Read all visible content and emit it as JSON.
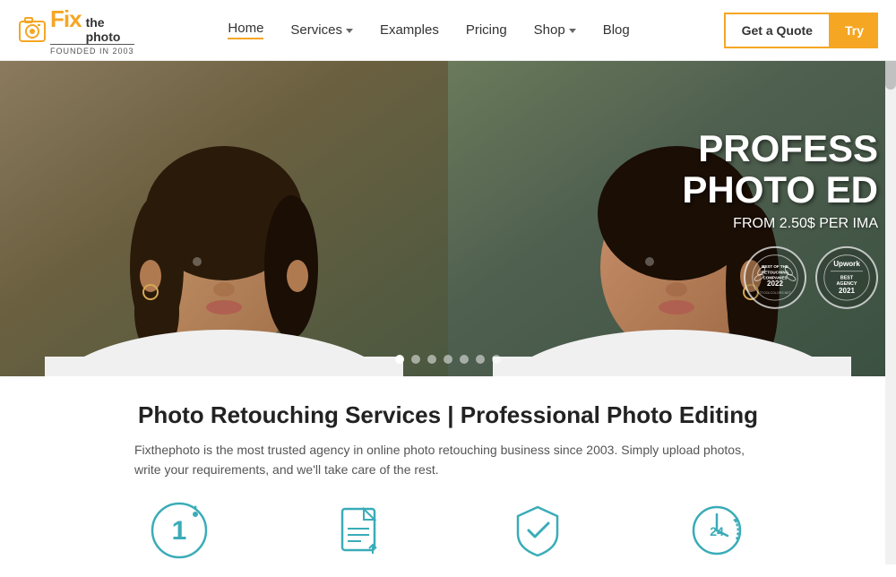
{
  "header": {
    "logo": {
      "fix": "Fix",
      "thephoto_line1": "the",
      "thephoto_line2": "photo",
      "founded": "FOUNDED IN 2003"
    },
    "nav": {
      "home": "Home",
      "services": "Services",
      "examples": "Examples",
      "pricing": "Pricing",
      "shop": "Shop",
      "blog": "Blog"
    },
    "buttons": {
      "quote": "Get a Quote",
      "try": "Try"
    }
  },
  "hero": {
    "title_line1": "PROFESS",
    "title_line2": "PHOTO ED",
    "subtitle": "FROM 2.50$ PER IMA",
    "badge1": {
      "line1": "BEST OF THE",
      "line2": "RETOUCHING",
      "line3": "COMPANIES",
      "year": "2022",
      "site": "© TOOLCOLORS.NET"
    },
    "badge2": {
      "brand": "Upwork",
      "line1": "BEST AGENCY",
      "year": "2021"
    },
    "dots_count": 7,
    "active_dot": 0
  },
  "main": {
    "section_title": "Photo Retouching Services | Professional Photo Editing",
    "section_desc": "Fixthephoto is the most trusted agency in online photo retouching business since 2003. Simply upload photos, write your requirements, and we'll take care of the rest.",
    "icons": [
      {
        "id": "icon1",
        "label": "1"
      },
      {
        "id": "icon2",
        "label": "doc"
      },
      {
        "id": "icon3",
        "label": "shield"
      },
      {
        "id": "icon4",
        "label": "24"
      }
    ]
  },
  "colors": {
    "accent": "#f5a623",
    "teal": "#3aacb8",
    "text_dark": "#222222",
    "text_gray": "#555555"
  }
}
